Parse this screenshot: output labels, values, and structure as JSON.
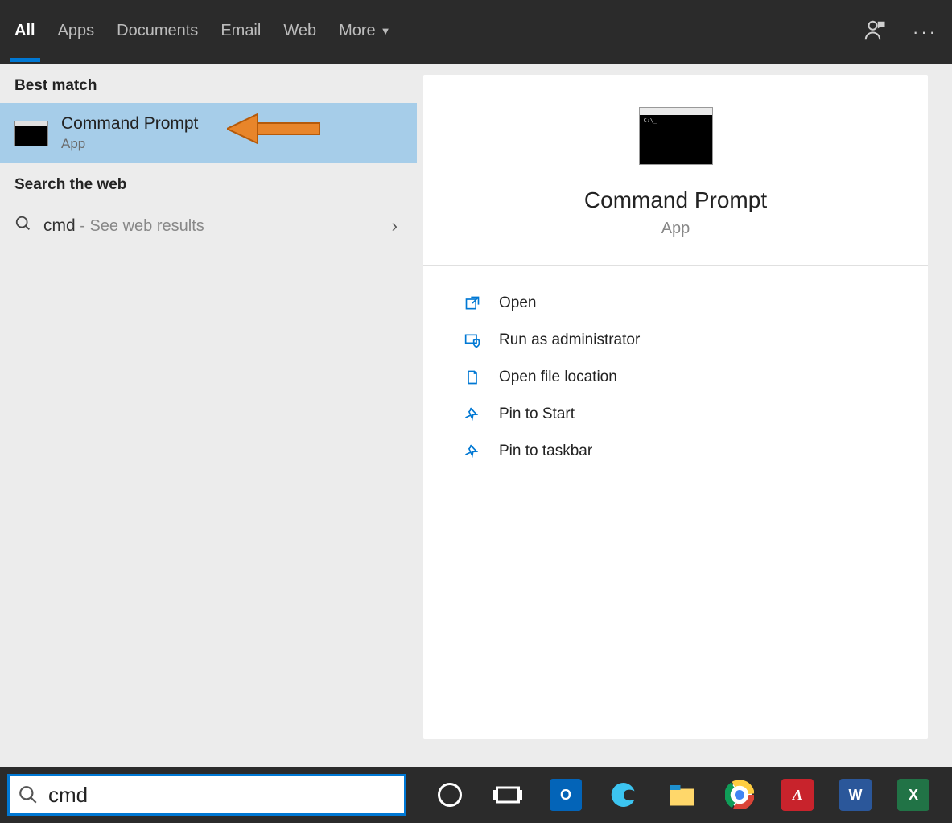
{
  "tabs": {
    "items": [
      "All",
      "Apps",
      "Documents",
      "Email",
      "Web"
    ],
    "more_label": "More",
    "active_index": 0
  },
  "left_panel": {
    "best_match_header": "Best match",
    "selected_result": {
      "title": "Command Prompt",
      "type": "App"
    },
    "web_header": "Search the web",
    "web_result": {
      "query": "cmd",
      "suffix": " - See web results"
    }
  },
  "preview": {
    "title": "Command Prompt",
    "type": "App",
    "actions": [
      "Open",
      "Run as administrator",
      "Open file location",
      "Pin to Start",
      "Pin to taskbar"
    ]
  },
  "search": {
    "value": "cmd"
  },
  "colors": {
    "accent": "#0078d4",
    "selection": "#a6cde9",
    "action_icon": "#0078d4"
  }
}
